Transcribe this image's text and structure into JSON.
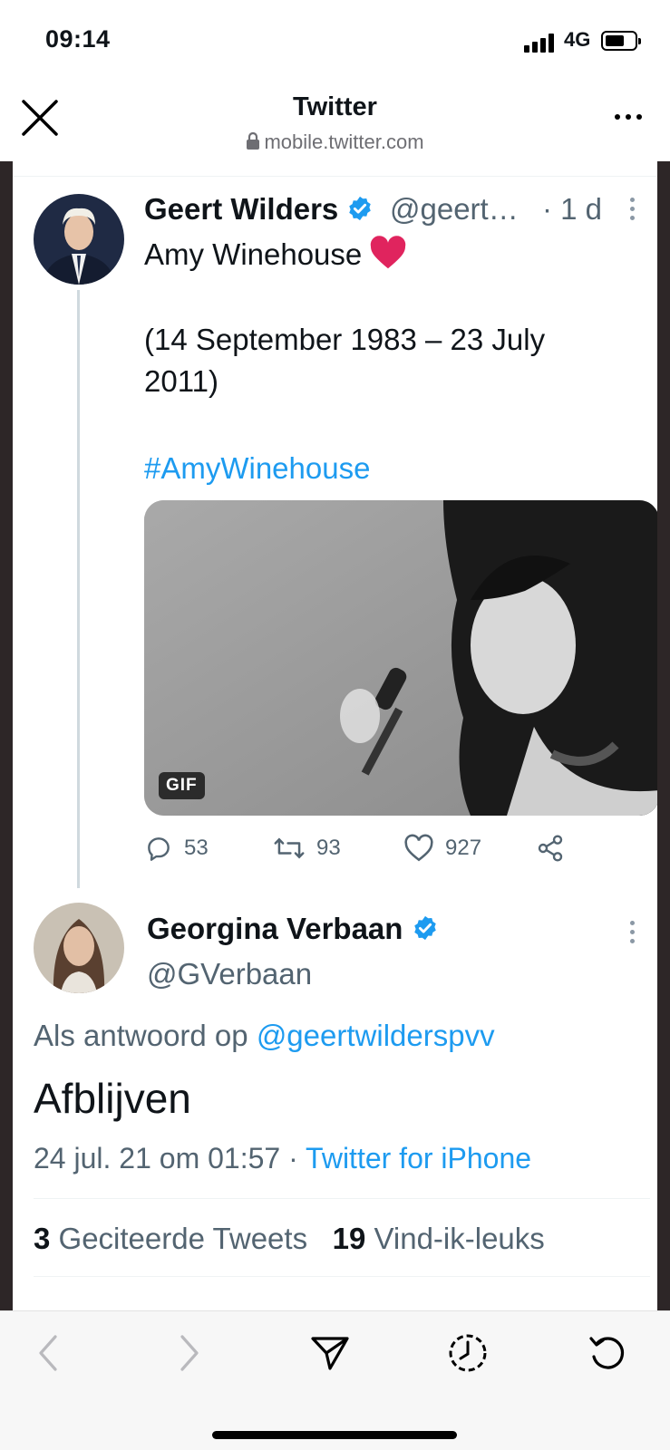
{
  "status_bar": {
    "time": "09:14",
    "network": "4G"
  },
  "browser": {
    "title": "Twitter",
    "url": "mobile.twitter.com"
  },
  "tweet": {
    "author_name": "Geert Wilders",
    "author_handle": "@geert…",
    "age": "· 1 d",
    "text_line1": "Amy Winehouse",
    "text_line2": "(14 September 1983 – 23 July",
    "text_line3": "2011)",
    "hashtag": "#AmyWinehouse",
    "media_badge": "GIF",
    "replies": "53",
    "retweets": "93",
    "likes": "927"
  },
  "reply": {
    "author_name": "Georgina Verbaan",
    "author_handle": "@GVerbaan",
    "reply_prefix": "Als antwoord op",
    "reply_to": "@geertwilderspvv",
    "text": "Afblijven",
    "timestamp": "24 jul. 21 om 01:57",
    "separator": "·",
    "source": "Twitter for iPhone",
    "quote_count": "3",
    "quote_label": "Geciteerde Tweets",
    "like_count": "19",
    "like_label": "Vind-ik-leuks"
  },
  "icons": {
    "verified": "verified-badge-icon",
    "heart_emoji": "red-heart-icon",
    "reply": "reply-icon",
    "retweet": "retweet-icon",
    "like": "like-icon",
    "share": "share-icon",
    "back": "back-icon",
    "forward": "forward-icon",
    "send": "send-icon",
    "history": "history-icon",
    "reload": "reload-icon"
  },
  "colors": {
    "link": "#1d9bf0",
    "secondary_text": "#536471",
    "verified": "#1d9bf0",
    "heart": "#e0245e"
  }
}
